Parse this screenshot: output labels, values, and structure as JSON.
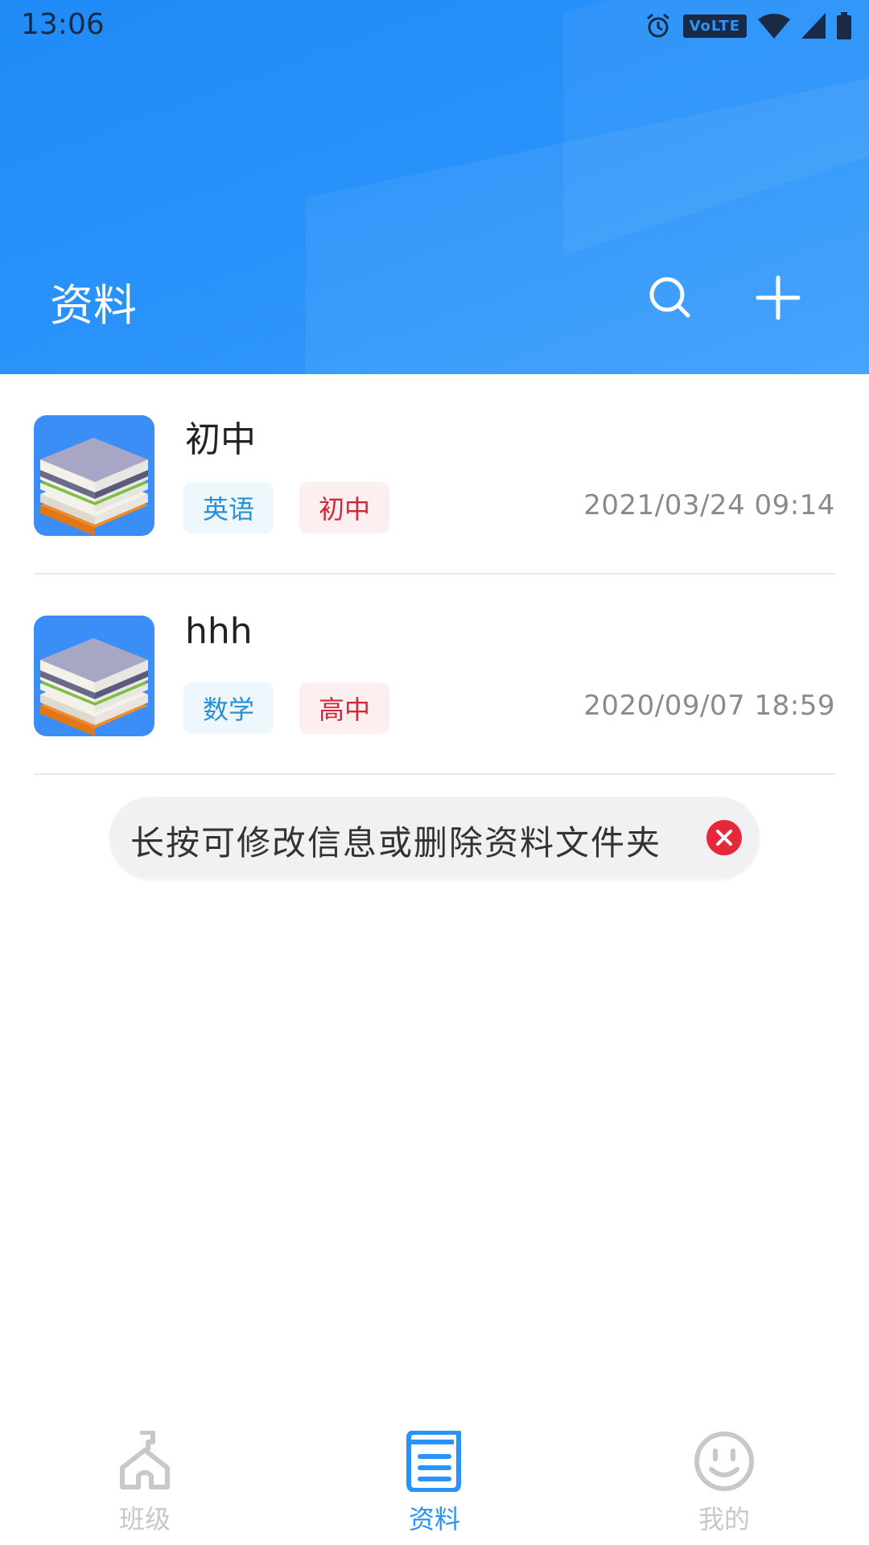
{
  "status_bar": {
    "time": "13:06",
    "volte_label": "VoLTE"
  },
  "header": {
    "title": "资料",
    "search_icon": "search-icon",
    "add_icon": "plus-icon",
    "background_color": "#2a93fa"
  },
  "folders": [
    {
      "name": "初中",
      "subject": "英语",
      "level": "初中",
      "time": "2021/03/24 09:14",
      "icon": "books-stack-icon"
    },
    {
      "name": "hhh",
      "subject": "数学",
      "level": "高中",
      "time": "2020/09/07 18:59",
      "icon": "books-stack-icon"
    }
  ],
  "tip": {
    "text": "长按可修改信息或删除资料文件夹",
    "close_icon": "close-icon",
    "close_color": "#e5283a"
  },
  "bottom_nav": {
    "items": [
      {
        "label": "班级",
        "icon": "class-icon",
        "active": false
      },
      {
        "label": "资料",
        "icon": "document-icon",
        "active": true
      },
      {
        "label": "我的",
        "icon": "smiley-icon",
        "active": false
      }
    ],
    "active_color": "#2a93fa",
    "inactive_color": "#c7c7cc"
  }
}
